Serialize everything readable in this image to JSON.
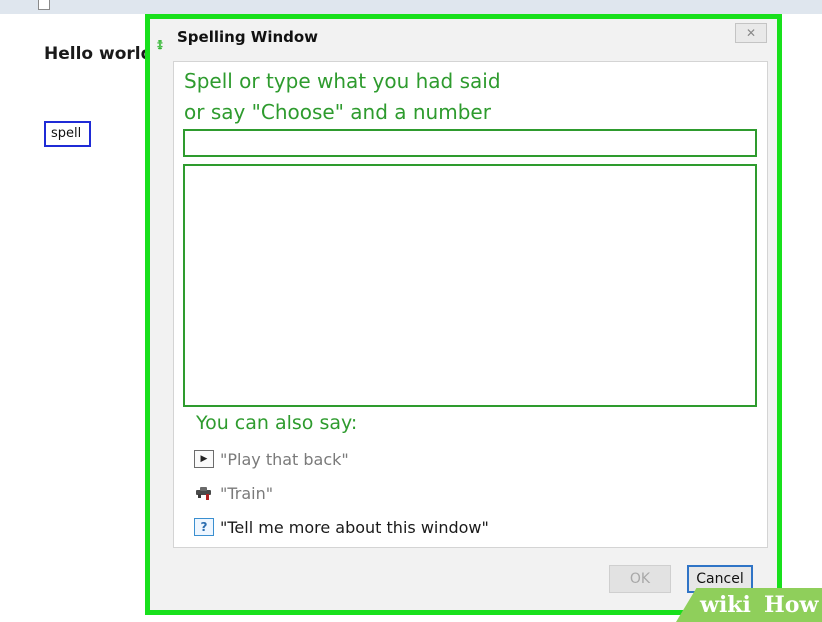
{
  "document": {
    "text": "Hello world",
    "spell_word": "spell"
  },
  "dialog": {
    "title": "Spelling Window",
    "close_label": "✕",
    "prompt_line1": "Spell or type what you had said",
    "prompt_line2": "or say \"Choose\" and a number",
    "input_value": "",
    "choices": [],
    "also_say": "You can also say:",
    "commands": [
      {
        "icon": "play-icon",
        "label": "\"Play that back\""
      },
      {
        "icon": "train-icon",
        "label": "\"Train\""
      },
      {
        "icon": "help-icon",
        "label": "\"Tell me more about this window\""
      }
    ],
    "ok_label": "OK",
    "cancel_label": "Cancel"
  },
  "colors": {
    "highlight": "#18e01c",
    "prompt_green": "#2e9b2e",
    "focus_blue": "#2f74c6",
    "spell_box_blue": "#1f2bd6"
  },
  "watermark": {
    "part1": "wiki",
    "part2": "How"
  }
}
